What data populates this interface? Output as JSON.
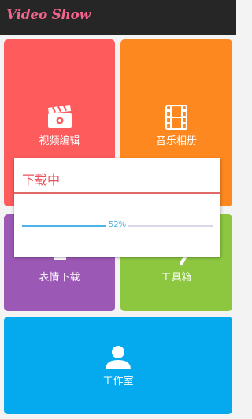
{
  "app": {
    "logo_text": "Video Show"
  },
  "tiles": {
    "video_edit": {
      "label": "视频编辑",
      "color": "#fe5b5d",
      "icon": "clapperboard-icon"
    },
    "music_album": {
      "label": "音乐相册",
      "color": "#fe8820",
      "icon": "film-strip-icon"
    },
    "emoji_download": {
      "label": "表情下载",
      "color": "#9b58b5",
      "icon": "download-icon"
    },
    "toolbox": {
      "label": "工具箱",
      "color": "#8cc73f",
      "icon": "wrench-icon"
    },
    "studio": {
      "label": "工作室",
      "color": "#05a9ee",
      "icon": "person-icon"
    }
  },
  "dialog": {
    "title": "下载中",
    "progress_percent": 52,
    "progress_text": "52%"
  }
}
